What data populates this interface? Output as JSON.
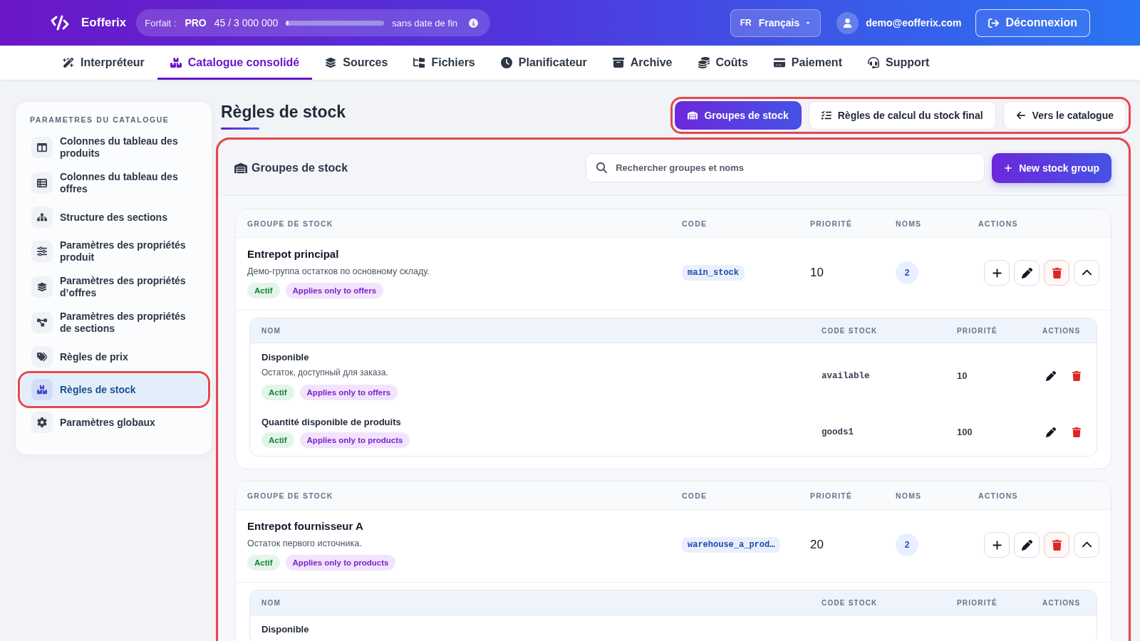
{
  "header": {
    "brand": "Eofferix",
    "plan": {
      "label": "Forfait :",
      "tier": "PRO",
      "usage": "45 / 3 000 000",
      "level": 0,
      "expiry": "sans date de fin"
    },
    "language": {
      "code": "FR",
      "name": "Français"
    },
    "user_email": "demo@eofferix.com",
    "logout_button": "Déconnexion"
  },
  "nav": [
    {
      "label": "Interpréteur",
      "selected": false
    },
    {
      "label": "Catalogue consolidé",
      "selected": true
    },
    {
      "label": "Sources",
      "selected": false
    },
    {
      "label": "Fichiers",
      "selected": false
    },
    {
      "label": "Planificateur",
      "selected": false
    },
    {
      "label": "Archive",
      "selected": false
    },
    {
      "label": "Coûts",
      "selected": false
    },
    {
      "label": "Paiement",
      "selected": false
    },
    {
      "label": "Support",
      "selected": false
    }
  ],
  "sidebar": {
    "title": "PARAMETRES DU CATALOGUE",
    "items": [
      {
        "label": "Colonnes du tableau des produits",
        "selected": false,
        "highlighted": false
      },
      {
        "label": "Colonnes du tableau des offres",
        "selected": false,
        "highlighted": false
      },
      {
        "label": "Structure des sections",
        "selected": false,
        "highlighted": false
      },
      {
        "label": "Paramètres des propriétés produit",
        "selected": false,
        "highlighted": false
      },
      {
        "label": "Paramètres des propriétés d’offres",
        "selected": false,
        "highlighted": false
      },
      {
        "label": "Paramètres des propriétés de sections",
        "selected": false,
        "highlighted": false
      },
      {
        "label": "Règles de prix",
        "selected": false,
        "highlighted": false
      },
      {
        "label": "Règles de stock",
        "selected": true,
        "highlighted": true
      },
      {
        "label": "Paramètres globaux",
        "selected": false,
        "highlighted": false
      }
    ]
  },
  "page": {
    "title": "Règles de stock",
    "view_tabs": {
      "highlighted": true,
      "items": [
        {
          "label": "Groupes de stock",
          "selected": true
        },
        {
          "label": "Règles de calcul du stock final",
          "selected": false
        },
        {
          "label": "Vers le catalogue",
          "selected": false
        }
      ]
    }
  },
  "panel": {
    "highlighted": true,
    "title": "Groupes de stock",
    "search": {
      "placeholder": "Rechercher groupes et noms"
    },
    "new_button": "New stock group",
    "groups": [
      {
        "columns": [
          "GROUPE DE STOCK",
          "CODE",
          "PRIORITÉ",
          "NOMS",
          "ACTIONS"
        ],
        "name": "Entrepot principal",
        "description": "Демо-группа остатков по основному складу.",
        "badges": [
          {
            "kind": "status",
            "text": "Actif"
          },
          {
            "kind": "scope",
            "text": "Applies only to offers"
          }
        ],
        "code": "main_stock",
        "priority": "10",
        "names_count": "2",
        "expanded": true,
        "names_columns": [
          "NOM",
          "CODE STOCK",
          "PRIORITÉ",
          "ACTIONS"
        ],
        "names": [
          {
            "name": "Disponible",
            "description": "Остаток, доступный для заказа.",
            "badges": [
              {
                "kind": "status",
                "text": "Actif"
              },
              {
                "kind": "scope",
                "text": "Applies only to offers"
              }
            ],
            "code": "available",
            "priority": "10"
          },
          {
            "name": "Quantité disponible de produits",
            "badges": [
              {
                "kind": "status",
                "text": "Actif"
              },
              {
                "kind": "scope",
                "text": "Applies only to products"
              }
            ],
            "code": "goods1",
            "priority": "100"
          }
        ]
      },
      {
        "columns": [
          "GROUPE DE STOCK",
          "CODE",
          "PRIORITÉ",
          "NOMS",
          "ACTIONS"
        ],
        "name": "Entrepot fournisseur A",
        "description": "Остаток первого источника.",
        "badges": [
          {
            "kind": "status",
            "text": "Actif"
          },
          {
            "kind": "scope",
            "text": "Applies only to products"
          }
        ],
        "code": "warehouse_a_prod…",
        "priority": "20",
        "names_count": "2",
        "expanded": true,
        "names_columns": [
          "NOM",
          "CODE STOCK",
          "PRIORITÉ",
          "ACTIONS"
        ],
        "names": [
          {
            "name": "Disponible"
          }
        ]
      }
    ]
  }
}
